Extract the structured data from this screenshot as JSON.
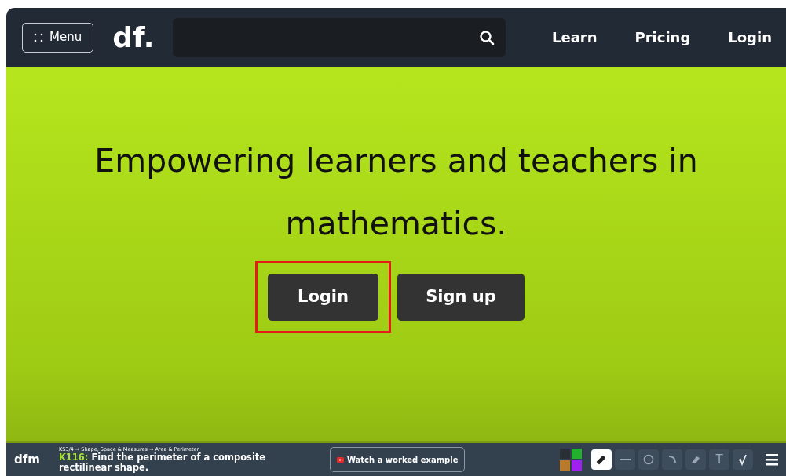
{
  "navbar": {
    "menu_button": {
      "label": "Menu"
    },
    "logo": "df.",
    "links": [
      {
        "label": "Learn"
      },
      {
        "label": "Pricing"
      },
      {
        "label": "Login"
      }
    ]
  },
  "hero": {
    "heading": "Empowering learners and teachers in mathematics.",
    "buttons": [
      {
        "label": "Login",
        "highlighted": true
      },
      {
        "label": "Sign up",
        "highlighted": false
      }
    ]
  },
  "bottom_bar": {
    "logo": "dfm",
    "breadcrumb": "KS3/4 → Shape, Space & Measures → Area & Perimeter",
    "code": "K116:",
    "title": "Find the perimeter of a composite rectilinear shape.",
    "video_button": "Watch a worked example",
    "swatches": [
      {
        "color": "#2a2f36"
      },
      {
        "color": "#22b02e"
      },
      {
        "color": "#b87a2c"
      },
      {
        "color": "#a020f0"
      }
    ],
    "tools": [
      {
        "kind": "pen",
        "selected": true
      },
      {
        "kind": "line",
        "selected": false
      },
      {
        "kind": "circle",
        "selected": false
      },
      {
        "kind": "arc",
        "selected": false
      },
      {
        "kind": "eraser",
        "selected": false
      },
      {
        "kind": "text",
        "label": "T",
        "selected": false
      },
      {
        "kind": "root",
        "selected": false
      }
    ]
  }
}
